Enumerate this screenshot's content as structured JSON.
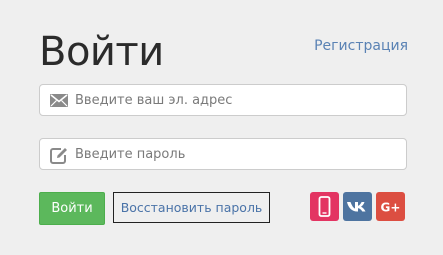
{
  "title": "Войти",
  "register_link": "Регистрация",
  "email": {
    "placeholder": "Введите ваш эл. адрес",
    "icon": "envelope-icon"
  },
  "password": {
    "placeholder": "Введите пароль",
    "icon": "edit-icon"
  },
  "login_button": "Войти",
  "recover_link": "Восстановить пароль",
  "social": [
    {
      "name": "phone",
      "icon": "mobile-phone-icon",
      "color": "#e33462"
    },
    {
      "name": "vk",
      "icon": "vk-icon",
      "color": "#4e74a0"
    },
    {
      "name": "google-plus",
      "icon": "google-plus-icon",
      "label": "G+",
      "color": "#dc4e41"
    }
  ],
  "colors": {
    "background": "#efefef",
    "accent_link": "#5a82b4",
    "button_green": "#5cb85c"
  }
}
